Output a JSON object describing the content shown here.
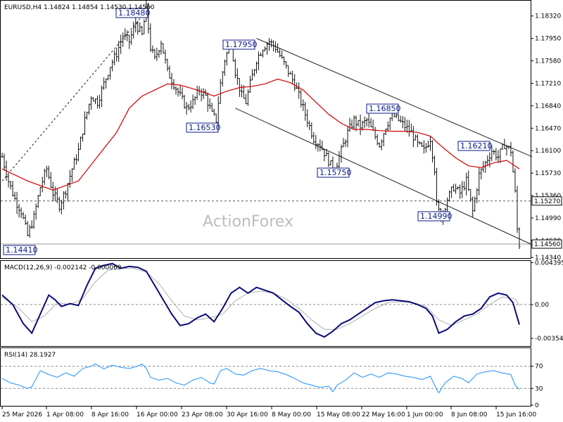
{
  "chart_data": [
    {
      "type": "candlestick",
      "title": "EURUSD,H4  1.14824 1.14854 1.14530 1.14560",
      "watermark": "ActionForex",
      "ylim": [
        1.1434,
        1.1856
      ],
      "y_ticks": [
        "1.18320",
        "1.17950",
        "1.17580",
        "1.17210",
        "1.16840",
        "1.16470",
        "1.16100",
        "1.15730",
        "1.15360",
        "1.14990",
        "1.14620",
        "1.14340"
      ],
      "current_price_label": "1.14560",
      "dashed_level_label": "1.15270",
      "dashed_level": 1.1527,
      "low_level": 1.1456,
      "x_labels": [
        "25 Mar 2026",
        "1 Apr 08:00",
        "8 Apr 16:00",
        "16 Apr 00:00",
        "23 Apr 08:00",
        "30 Apr 16:00",
        "8 May 00:00",
        "15 May 08:00",
        "22 May 16:00",
        "1 Jun 00:00",
        "8 Jun 08:00",
        "15 Jun 16:00"
      ],
      "annotations": [
        {
          "label": "1.18480",
          "value": 1.1848
        },
        {
          "label": "1.17950",
          "value": 1.1795
        },
        {
          "label": "1.16530",
          "value": 1.1653
        },
        {
          "label": "1.16850",
          "value": 1.1685
        },
        {
          "label": "1.15750",
          "value": 1.1575
        },
        {
          "label": "1.16210",
          "value": 1.1621
        },
        {
          "label": "1.14990",
          "value": 1.1499
        },
        {
          "label": "1.14410",
          "value": 1.1441
        }
      ],
      "close_path": [
        [
          0,
          1.16
        ],
        [
          3,
          1.156
        ],
        [
          6,
          1.153
        ],
        [
          9,
          1.151
        ],
        [
          12,
          1.147
        ],
        [
          15,
          1.15
        ],
        [
          18,
          1.155
        ],
        [
          21,
          1.158
        ],
        [
          24,
          1.154
        ],
        [
          27,
          1.152
        ],
        [
          30,
          1.1545
        ],
        [
          33,
          1.158
        ],
        [
          36,
          1.161
        ],
        [
          39,
          1.166
        ],
        [
          42,
          1.17
        ],
        [
          45,
          1.169
        ],
        [
          48,
          1.172
        ],
        [
          51,
          1.175
        ],
        [
          54,
          1.177
        ],
        [
          57,
          1.18
        ],
        [
          60,
          1.179
        ],
        [
          63,
          1.182
        ],
        [
          66,
          1.18
        ],
        [
          68,
          1.1845
        ],
        [
          70,
          1.178
        ],
        [
          72,
          1.176
        ],
        [
          75,
          1.179
        ],
        [
          78,
          1.174
        ],
        [
          81,
          1.172
        ],
        [
          84,
          1.17
        ],
        [
          87,
          1.168
        ],
        [
          90,
          1.169
        ],
        [
          93,
          1.171
        ],
        [
          96,
          1.17
        ],
        [
          99,
          1.167
        ],
        [
          101,
          1.166
        ],
        [
          103,
          1.172
        ],
        [
          105,
          1.176
        ],
        [
          108,
          1.179
        ],
        [
          110,
          1.174
        ],
        [
          113,
          1.17
        ],
        [
          115,
          1.169
        ],
        [
          117,
          1.172
        ],
        [
          120,
          1.176
        ],
        [
          123,
          1.178
        ],
        [
          126,
          1.179
        ],
        [
          129,
          1.178
        ],
        [
          132,
          1.176
        ],
        [
          135,
          1.174
        ],
        [
          138,
          1.172
        ],
        [
          141,
          1.169
        ],
        [
          144,
          1.166
        ],
        [
          147,
          1.163
        ],
        [
          150,
          1.162
        ],
        [
          153,
          1.16
        ],
        [
          156,
          1.158
        ],
        [
          158,
          1.159
        ],
        [
          160,
          1.161
        ],
        [
          163,
          1.164
        ],
        [
          166,
          1.166
        ],
        [
          169,
          1.165
        ],
        [
          172,
          1.166
        ],
        [
          175,
          1.164
        ],
        [
          178,
          1.162
        ],
        [
          181,
          1.165
        ],
        [
          184,
          1.167
        ],
        [
          187,
          1.166
        ],
        [
          190,
          1.165
        ],
        [
          193,
          1.164
        ],
        [
          196,
          1.162
        ],
        [
          199,
          1.161
        ],
        [
          202,
          1.163
        ],
        [
          204,
          1.158
        ],
        [
          205,
          1.152
        ],
        [
          207,
          1.15
        ],
        [
          210,
          1.153
        ],
        [
          213,
          1.155
        ],
        [
          216,
          1.154
        ],
        [
          219,
          1.156
        ],
        [
          222,
          1.151
        ],
        [
          225,
          1.157
        ],
        [
          228,
          1.159
        ],
        [
          231,
          1.161
        ],
        [
          234,
          1.16
        ],
        [
          237,
          1.162
        ],
        [
          240,
          1.161
        ],
        [
          242,
          1.154
        ],
        [
          243,
          1.148
        ],
        [
          244,
          1.1456
        ]
      ],
      "ma": [
        [
          0,
          1.158
        ],
        [
          12,
          1.156
        ],
        [
          24,
          1.1545
        ],
        [
          36,
          1.156
        ],
        [
          45,
          1.16
        ],
        [
          54,
          1.164
        ],
        [
          60,
          1.168
        ],
        [
          66,
          1.17
        ],
        [
          72,
          1.171
        ],
        [
          78,
          1.172
        ],
        [
          84,
          1.1718
        ],
        [
          90,
          1.1712
        ],
        [
          96,
          1.1705
        ],
        [
          100,
          1.17
        ],
        [
          106,
          1.1708
        ],
        [
          112,
          1.1714
        ],
        [
          118,
          1.1716
        ],
        [
          124,
          1.172
        ],
        [
          130,
          1.1728
        ],
        [
          136,
          1.1722
        ],
        [
          142,
          1.171
        ],
        [
          148,
          1.169
        ],
        [
          154,
          1.167
        ],
        [
          160,
          1.1655
        ],
        [
          166,
          1.1645
        ],
        [
          172,
          1.1645
        ],
        [
          178,
          1.1643
        ],
        [
          184,
          1.1642
        ],
        [
          190,
          1.1642
        ],
        [
          196,
          1.164
        ],
        [
          202,
          1.1634
        ],
        [
          208,
          1.1615
        ],
        [
          214,
          1.1598
        ],
        [
          220,
          1.1585
        ],
        [
          226,
          1.1582
        ],
        [
          232,
          1.159
        ],
        [
          238,
          1.1594
        ],
        [
          244,
          1.158
        ]
      ],
      "trend_lines": [
        {
          "from": [
            0,
            1.156
          ],
          "to": [
            70,
            1.1848
          ]
        },
        {
          "from": [
            120,
            1.1795
          ],
          "to": [
            250,
            1.16
          ]
        },
        {
          "from": [
            110,
            1.168
          ],
          "to": [
            250,
            1.1455
          ]
        }
      ]
    },
    {
      "type": "line",
      "title": "MACD(12,26,9) -0.002142 -0.000069",
      "ylim": [
        -0.0042,
        0.0045
      ],
      "y_ticks": [
        "0.004395",
        "0.00",
        "-0.00354"
      ],
      "zero_level": 0,
      "macd": [
        [
          0,
          0.001
        ],
        [
          5,
          0.0
        ],
        [
          10,
          -0.002
        ],
        [
          14,
          -0.003
        ],
        [
          18,
          -0.001
        ],
        [
          22,
          0.001
        ],
        [
          25,
          0.0005
        ],
        [
          28,
          -0.0002
        ],
        [
          32,
          0.0001
        ],
        [
          36,
          -0.0001
        ],
        [
          40,
          0.002
        ],
        [
          44,
          0.0038
        ],
        [
          48,
          0.0041
        ],
        [
          52,
          0.0043
        ],
        [
          56,
          0.0038
        ],
        [
          60,
          0.004
        ],
        [
          64,
          0.0039
        ],
        [
          68,
          0.0035
        ],
        [
          72,
          0.002
        ],
        [
          76,
          0.0005
        ],
        [
          80,
          -0.001
        ],
        [
          84,
          -0.0022
        ],
        [
          88,
          -0.002
        ],
        [
          92,
          -0.0014
        ],
        [
          96,
          -0.001
        ],
        [
          100,
          -0.0018
        ],
        [
          104,
          -0.0004
        ],
        [
          108,
          0.0012
        ],
        [
          112,
          0.0018
        ],
        [
          116,
          0.0012
        ],
        [
          120,
          0.0018
        ],
        [
          124,
          0.0015
        ],
        [
          128,
          0.0012
        ],
        [
          132,
          0.0005
        ],
        [
          136,
          -0.0002
        ],
        [
          140,
          -0.0008
        ],
        [
          144,
          -0.002
        ],
        [
          148,
          -0.003
        ],
        [
          152,
          -0.0034
        ],
        [
          156,
          -0.0028
        ],
        [
          160,
          -0.002
        ],
        [
          164,
          -0.0016
        ],
        [
          168,
          -0.001
        ],
        [
          172,
          -0.0004
        ],
        [
          176,
          0.0002
        ],
        [
          180,
          0.0004
        ],
        [
          184,
          0.0005
        ],
        [
          188,
          0.0004
        ],
        [
          192,
          0.0003
        ],
        [
          196,
          0.0
        ],
        [
          200,
          -0.0004
        ],
        [
          203,
          -0.0012
        ],
        [
          206,
          -0.003
        ],
        [
          210,
          -0.0026
        ],
        [
          214,
          -0.0018
        ],
        [
          218,
          -0.0012
        ],
        [
          222,
          -0.001
        ],
        [
          226,
          -0.0004
        ],
        [
          230,
          0.0008
        ],
        [
          234,
          0.0012
        ],
        [
          238,
          0.001
        ],
        [
          241,
          0.0002
        ],
        [
          244,
          -0.0021
        ]
      ],
      "signal": [
        [
          0,
          0.0008
        ],
        [
          8,
          -0.0004
        ],
        [
          14,
          -0.0018
        ],
        [
          20,
          -0.0012
        ],
        [
          26,
          0.0002
        ],
        [
          32,
          0.0
        ],
        [
          38,
          0.0006
        ],
        [
          44,
          0.0024
        ],
        [
          50,
          0.0036
        ],
        [
          56,
          0.0038
        ],
        [
          62,
          0.0038
        ],
        [
          68,
          0.0034
        ],
        [
          74,
          0.0022
        ],
        [
          80,
          0.0004
        ],
        [
          86,
          -0.0012
        ],
        [
          92,
          -0.0016
        ],
        [
          98,
          -0.0014
        ],
        [
          104,
          -0.001
        ],
        [
          110,
          0.0004
        ],
        [
          116,
          0.0012
        ],
        [
          122,
          0.0014
        ],
        [
          128,
          0.0012
        ],
        [
          134,
          0.0006
        ],
        [
          140,
          -0.0004
        ],
        [
          146,
          -0.0016
        ],
        [
          152,
          -0.0026
        ],
        [
          158,
          -0.0026
        ],
        [
          164,
          -0.002
        ],
        [
          170,
          -0.0012
        ],
        [
          176,
          -0.0004
        ],
        [
          182,
          0.0002
        ],
        [
          188,
          0.0003
        ],
        [
          194,
          0.0002
        ],
        [
          200,
          -0.0002
        ],
        [
          206,
          -0.0016
        ],
        [
          212,
          -0.0022
        ],
        [
          218,
          -0.0016
        ],
        [
          224,
          -0.001
        ],
        [
          230,
          0.0
        ],
        [
          236,
          0.0008
        ],
        [
          242,
          0.0006
        ],
        [
          244,
          -0.0001
        ]
      ]
    },
    {
      "type": "line",
      "title": "RSI(14) 28.1927",
      "ylim": [
        0,
        100
      ],
      "y_ticks": [
        "70",
        "30",
        "0"
      ],
      "levels": [
        70,
        30
      ],
      "rsi": [
        [
          0,
          48
        ],
        [
          4,
          40
        ],
        [
          8,
          36
        ],
        [
          12,
          30
        ],
        [
          14,
          33
        ],
        [
          18,
          62
        ],
        [
          22,
          55
        ],
        [
          26,
          50
        ],
        [
          30,
          58
        ],
        [
          34,
          52
        ],
        [
          38,
          66
        ],
        [
          42,
          70
        ],
        [
          44,
          74
        ],
        [
          48,
          65
        ],
        [
          52,
          72
        ],
        [
          56,
          68
        ],
        [
          60,
          66
        ],
        [
          64,
          70
        ],
        [
          66,
          74
        ],
        [
          68,
          66
        ],
        [
          70,
          50
        ],
        [
          74,
          45
        ],
        [
          78,
          48
        ],
        [
          82,
          40
        ],
        [
          86,
          36
        ],
        [
          90,
          45
        ],
        [
          94,
          50
        ],
        [
          98,
          40
        ],
        [
          100,
          38
        ],
        [
          103,
          62
        ],
        [
          106,
          66
        ],
        [
          110,
          56
        ],
        [
          114,
          54
        ],
        [
          118,
          62
        ],
        [
          122,
          66
        ],
        [
          126,
          62
        ],
        [
          130,
          60
        ],
        [
          134,
          55
        ],
        [
          138,
          48
        ],
        [
          142,
          40
        ],
        [
          146,
          36
        ],
        [
          150,
          32
        ],
        [
          154,
          34
        ],
        [
          156,
          24
        ],
        [
          158,
          36
        ],
        [
          162,
          45
        ],
        [
          166,
          58
        ],
        [
          170,
          50
        ],
        [
          174,
          56
        ],
        [
          178,
          50
        ],
        [
          182,
          58
        ],
        [
          186,
          56
        ],
        [
          190,
          52
        ],
        [
          194,
          50
        ],
        [
          198,
          46
        ],
        [
          202,
          52
        ],
        [
          204,
          36
        ],
        [
          206,
          22
        ],
        [
          209,
          40
        ],
        [
          213,
          52
        ],
        [
          217,
          48
        ],
        [
          220,
          40
        ],
        [
          224,
          56
        ],
        [
          228,
          60
        ],
        [
          232,
          62
        ],
        [
          236,
          58
        ],
        [
          240,
          55
        ],
        [
          242,
          36
        ],
        [
          244,
          28
        ]
      ]
    }
  ]
}
